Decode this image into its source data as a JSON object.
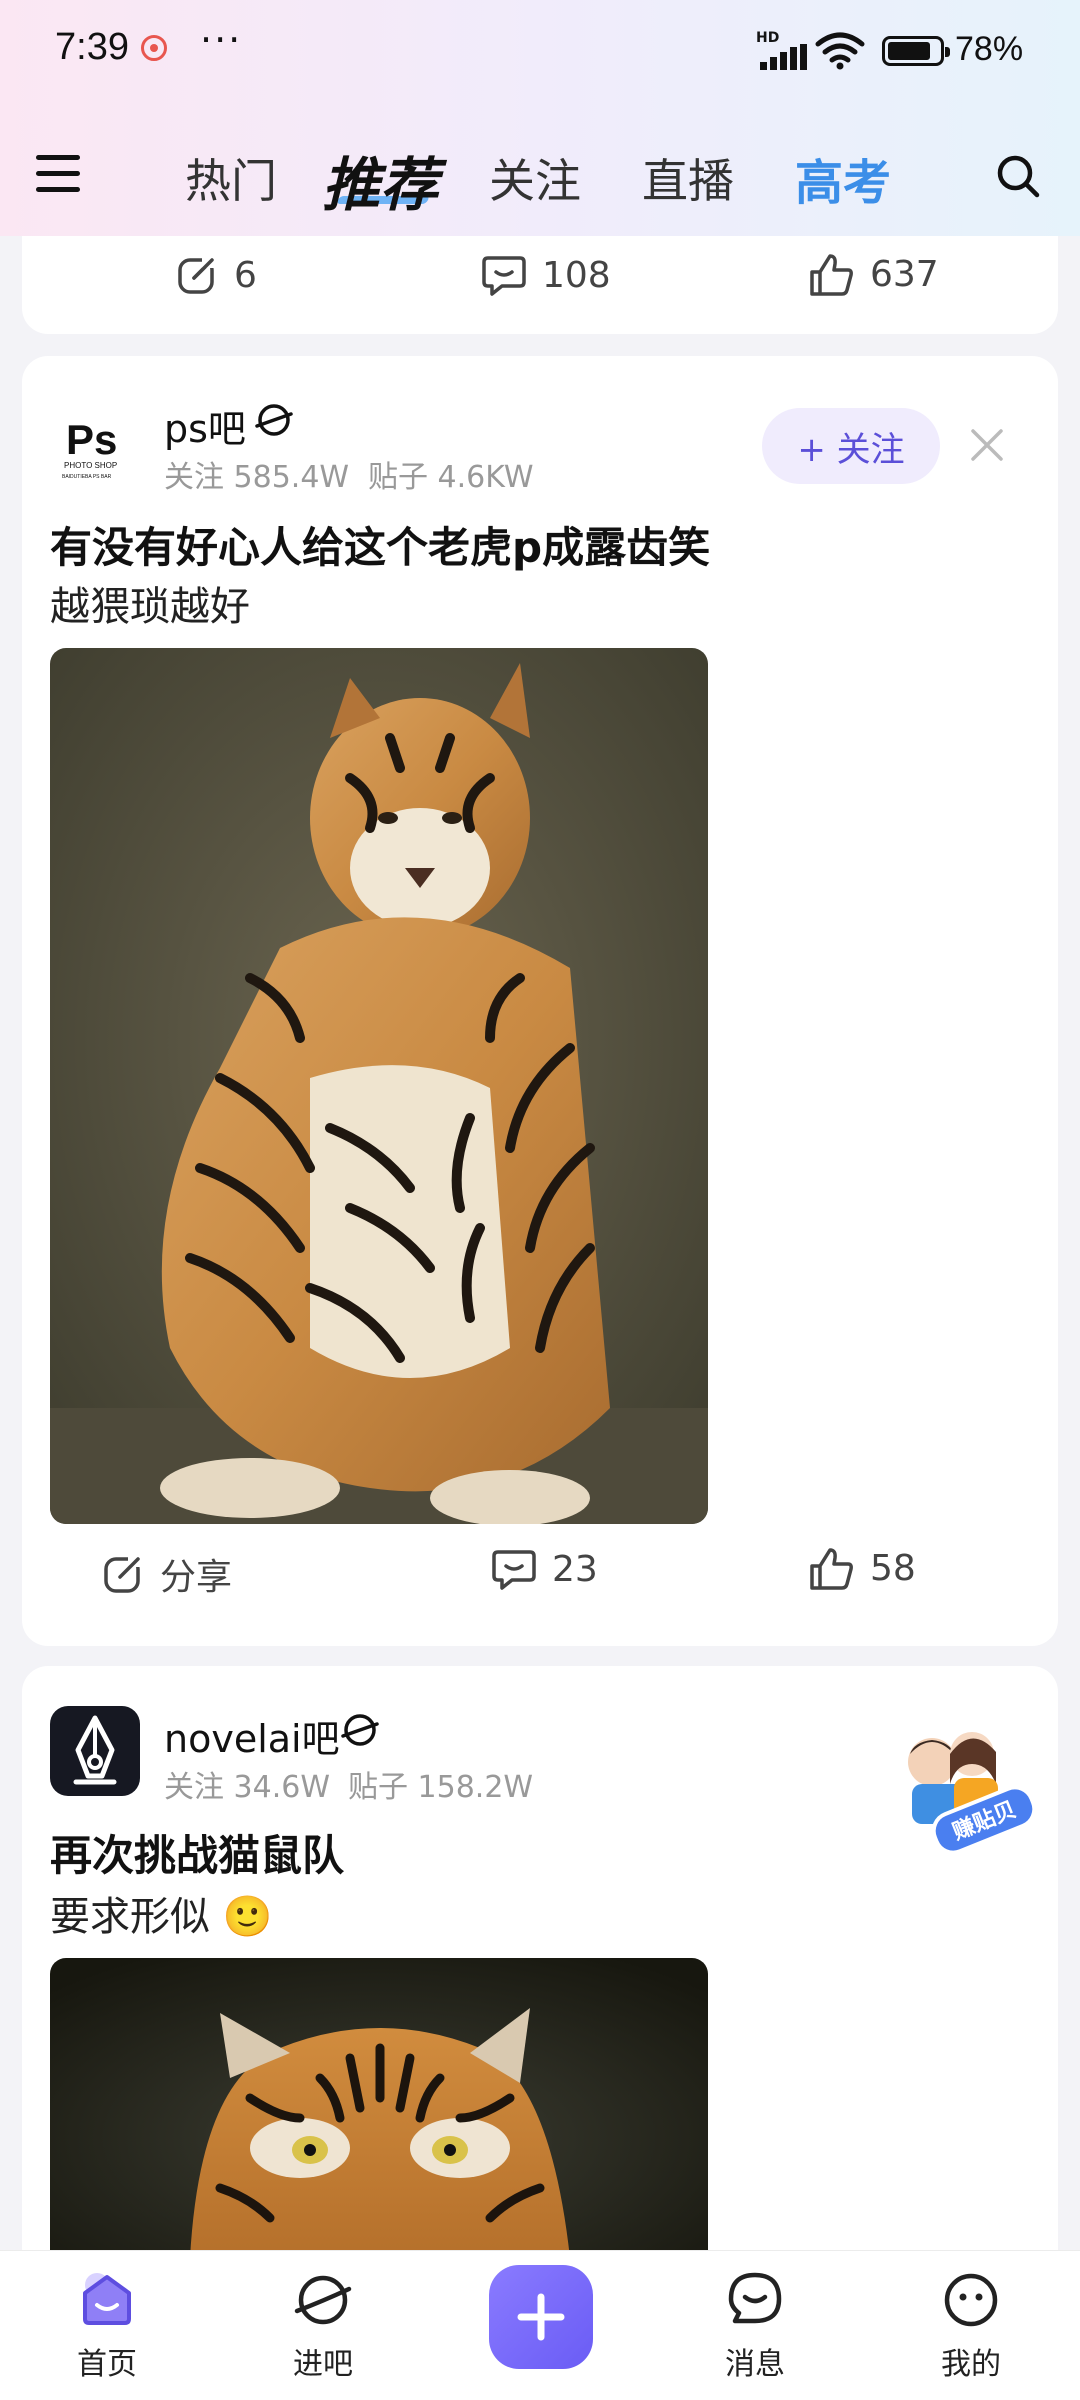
{
  "status_bar": {
    "time": "7:39",
    "dots": "···",
    "network_badge": "HD",
    "battery_pct": "78%"
  },
  "topnav": {
    "tabs": [
      {
        "label": "热门"
      },
      {
        "label": "推荐"
      },
      {
        "label": "关注"
      },
      {
        "label": "直播"
      },
      {
        "label": "高考"
      }
    ]
  },
  "prev_post": {
    "share_count": "6",
    "comment_count": "108",
    "like_count": "637"
  },
  "post1": {
    "avatar_text": "Ps",
    "avatar_sub": "PHOTO SHOP",
    "avatar_sub2": "BAIDUTIEBA PS BAR",
    "forum_name": "ps吧",
    "followers": "关注 585.4W",
    "posts": "贴子 4.6KW",
    "follow_label": "+ 关注",
    "title": "有没有好心人给这个老虎p成露齿笑",
    "body": "越猥琐越好",
    "share_label": "分享",
    "comment_count": "23",
    "like_count": "58"
  },
  "post2": {
    "forum_name": "novelai吧",
    "followers": "关注 34.6W",
    "posts": "贴子 158.2W",
    "badge_text": "赚贴贝",
    "title": "再次挑战猫鼠队",
    "body": "要求形似 🙂"
  },
  "tabbar": {
    "items": [
      {
        "label": "首页"
      },
      {
        "label": "进吧"
      },
      {
        "label": "消息"
      },
      {
        "label": "我的"
      }
    ]
  },
  "colors": {
    "accent": "#6a5cf5",
    "gaokao": "#3b8ee8",
    "follow_bg": "#f0ecfd"
  }
}
